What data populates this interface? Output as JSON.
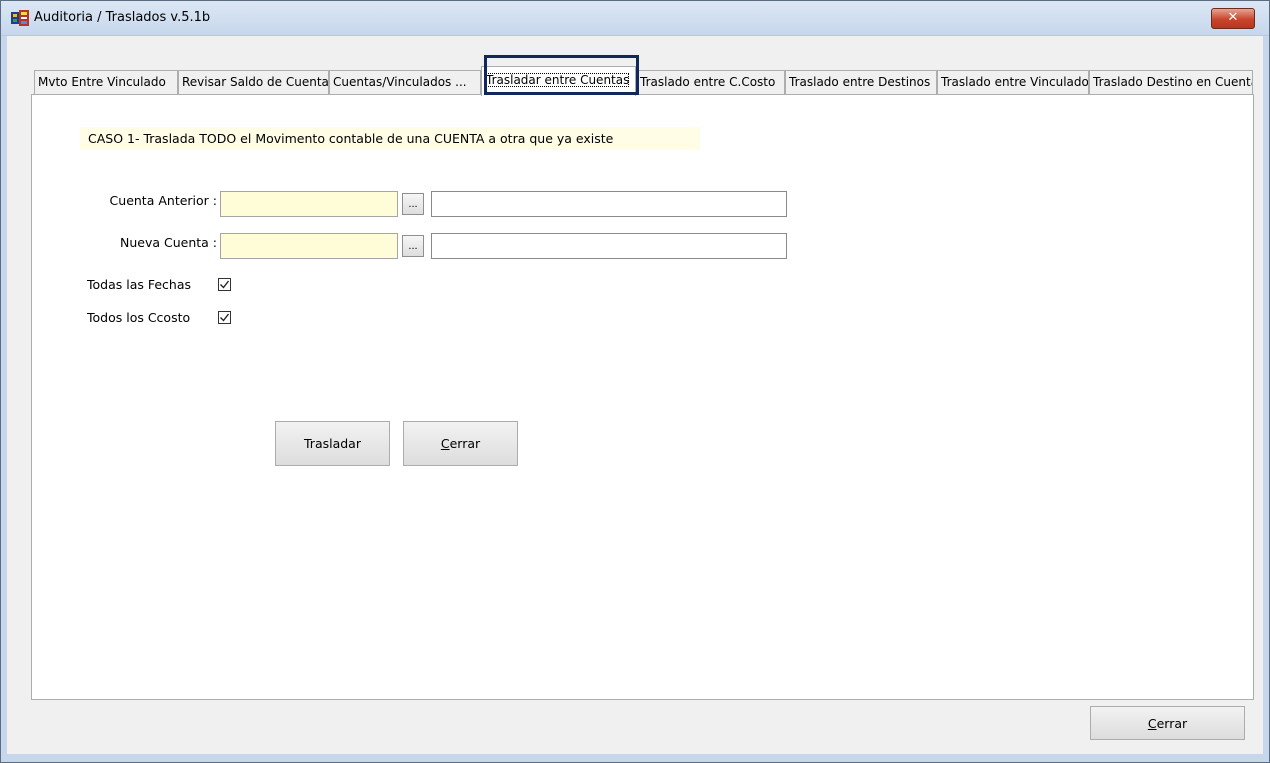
{
  "window": {
    "title": "Auditoria / Traslados  v.5.1b",
    "close_glyph": "✕"
  },
  "tabs": [
    {
      "label": "Mvto Entre Vinculado",
      "active": false
    },
    {
      "label": "Revisar Saldo de Cuentas",
      "active": false
    },
    {
      "label": "Cuentas/Vinculados ...",
      "active": false
    },
    {
      "label": "Trasladar entre Cuentas",
      "active": true
    },
    {
      "label": "Traslado entre C.Costo",
      "active": false
    },
    {
      "label": "Traslado entre Destinos",
      "active": false
    },
    {
      "label": "Traslado entre Vinculados",
      "active": false
    },
    {
      "label": "Traslado Destino en Cuenta",
      "active": false
    }
  ],
  "panel": {
    "note": "CASO 1-   Traslada TODO el Movimento contable de una CUENTA a otra que ya existe",
    "cuenta_anterior_label": "Cuenta Anterior :",
    "cuenta_anterior_value": "",
    "cuenta_anterior_desc": "",
    "nueva_cuenta_label": "Nueva Cuenta :",
    "nueva_cuenta_value": "",
    "nueva_cuenta_desc": "",
    "browse_label": "...",
    "todas_fechas_label": "Todas las Fechas",
    "todas_fechas_checked": true,
    "todos_ccosto_label": "Todos los Ccosto",
    "todos_ccosto_checked": true,
    "trasladar_label": "Trasladar",
    "cerrar_first": "C",
    "cerrar_rest": "errar"
  },
  "footer": {
    "cerrar_first": "C",
    "cerrar_rest": "errar"
  },
  "icons": {
    "app": "app-icon",
    "checkmark": "checkmark-icon"
  }
}
